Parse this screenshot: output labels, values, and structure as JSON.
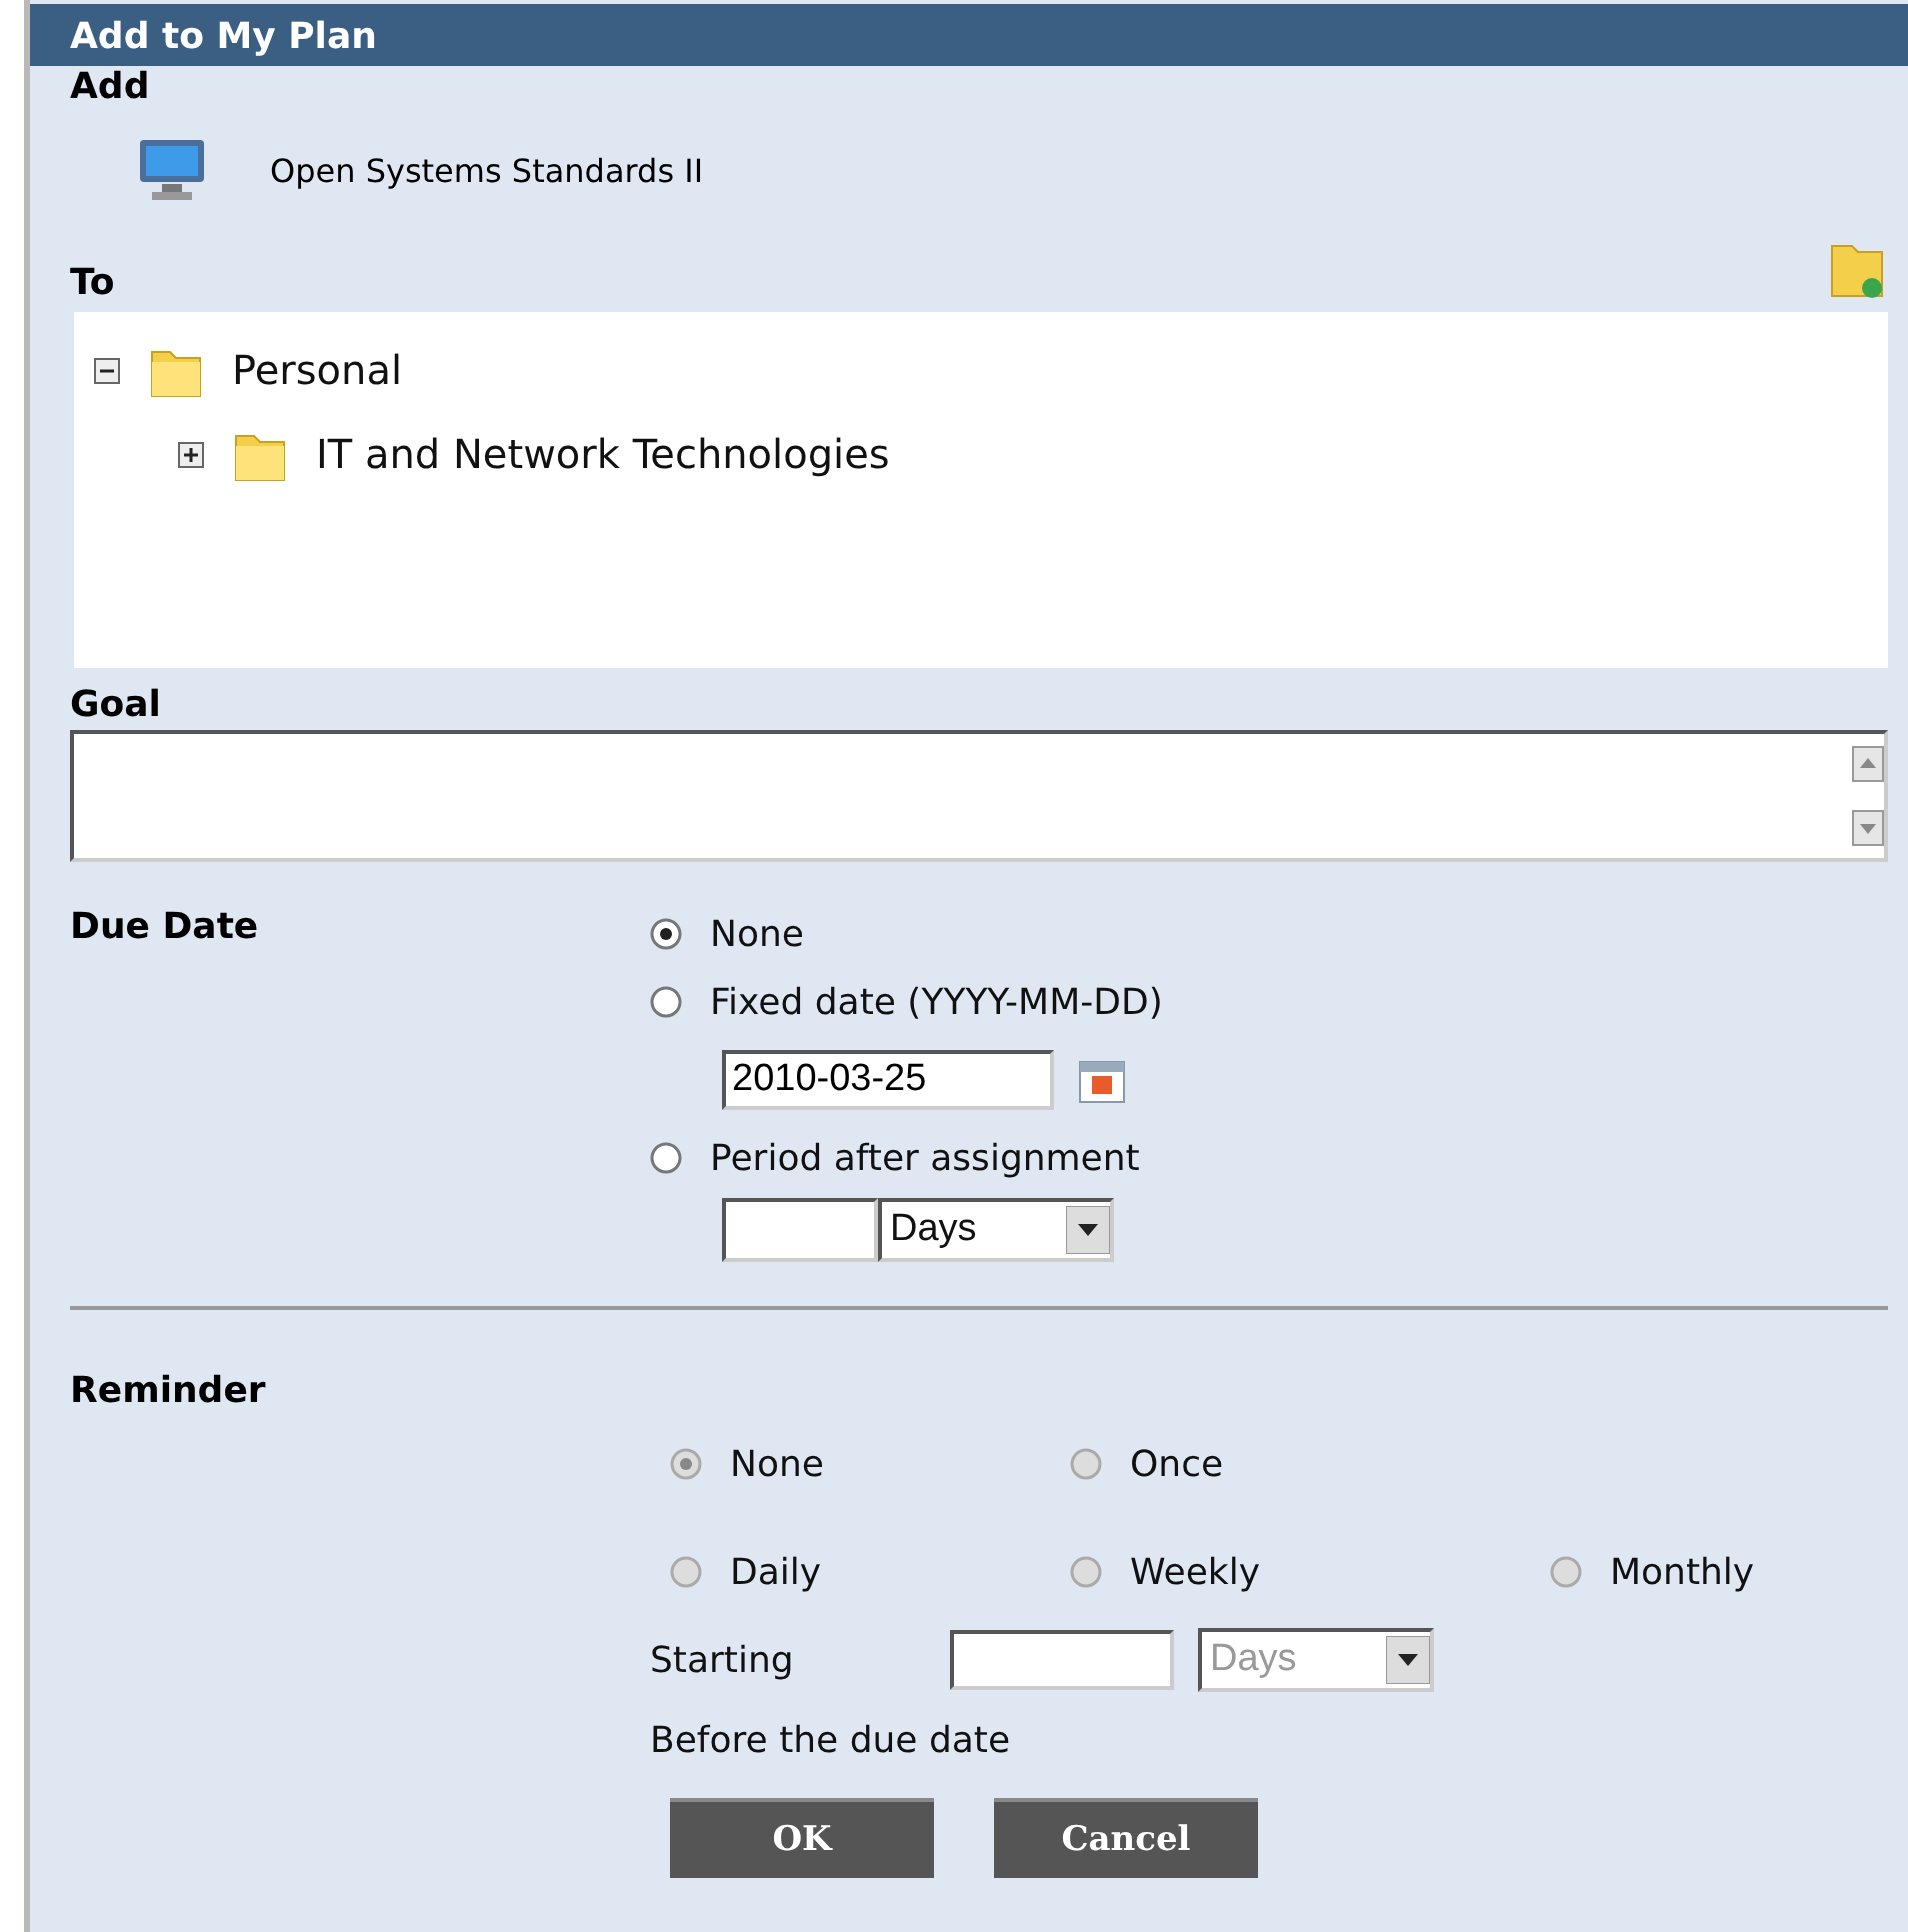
{
  "dialog": {
    "title": "Add to My Plan"
  },
  "add": {
    "label": "Add",
    "item": "Open Systems Standards II"
  },
  "to": {
    "label": "To",
    "tree": [
      {
        "label": "Personal",
        "expanded": true,
        "children": [
          {
            "label": "IT and Network Technologies",
            "expanded": false
          }
        ]
      }
    ]
  },
  "goal": {
    "label": "Goal"
  },
  "due_date": {
    "label": "Due Date",
    "options": [
      {
        "kind": "none",
        "label": "None",
        "selected": true
      },
      {
        "kind": "fixed",
        "label": "Fixed date (YYYY-MM-DD)",
        "selected": false
      },
      {
        "kind": "period",
        "label": "Period after assignment",
        "selected": false
      }
    ],
    "date_value": "2010-03-25",
    "period_unit": "Days"
  },
  "reminder": {
    "label": "Reminder",
    "disabled": true,
    "options": [
      {
        "label": "None",
        "selected": true
      },
      {
        "label": "Once",
        "selected": false
      },
      {
        "label": "Daily",
        "selected": false
      },
      {
        "label": "Weekly",
        "selected": false
      },
      {
        "label": "Monthly",
        "selected": false
      }
    ],
    "starting_label": "Starting",
    "starting_unit": "Days",
    "note": "Before the due date"
  },
  "buttons": [
    "OK",
    "Cancel"
  ]
}
